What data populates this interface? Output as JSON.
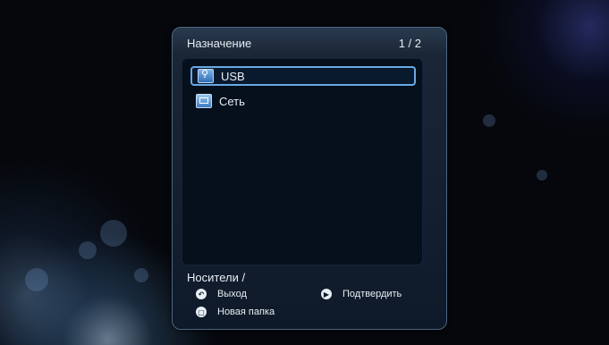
{
  "dialog": {
    "title": "Назначение",
    "page_indicator": "1 / 2"
  },
  "destinations": [
    {
      "label": "USB",
      "icon": "usb-icon",
      "selected": true
    },
    {
      "label": "Сеть",
      "icon": "network-icon",
      "selected": false
    }
  ],
  "path": "Носители /",
  "hints": {
    "exit": "Выход",
    "confirm": "Подтвердить",
    "new_folder": "Новая папка"
  },
  "colors": {
    "selection_border": "#6aa8e6",
    "panel_bg": "#0e1a29"
  }
}
